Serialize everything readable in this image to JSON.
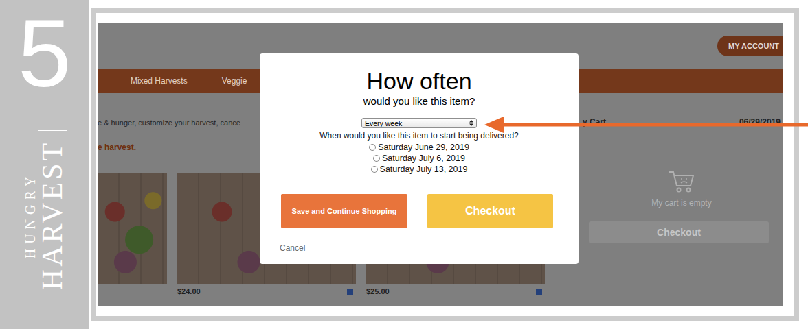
{
  "sidebar": {
    "step": "5",
    "logo": {
      "top": "HUNGRY",
      "bottom": "HARVEST"
    }
  },
  "page": {
    "account_button": "MY ACCOUNT",
    "nav": [
      "Mixed Harvests",
      "Veggie"
    ],
    "intro": "e & hunger, customize your harvest, cance",
    "intro_link": "e harvest.",
    "products": [
      {
        "price": "$24.00"
      },
      {
        "price": "$25.00"
      }
    ]
  },
  "cart": {
    "title": "y Cart",
    "date": "06/29/2019",
    "empty_text": "My cart is empty",
    "checkout": "Checkout"
  },
  "modal": {
    "title": "How often",
    "subtitle": "would you like this item?",
    "frequency": "Every week",
    "start_prompt": "When would you like this item to start being delivered?",
    "dates": [
      {
        "label": "Saturday June 29, 2019",
        "selected": false
      },
      {
        "label": "Saturday July 6, 2019",
        "selected": false
      },
      {
        "label": "Saturday July 13, 2019",
        "selected": false
      }
    ],
    "buttons": {
      "save": "Save and Continue Shopping",
      "checkout": "Checkout"
    },
    "cancel": "Cancel"
  }
}
